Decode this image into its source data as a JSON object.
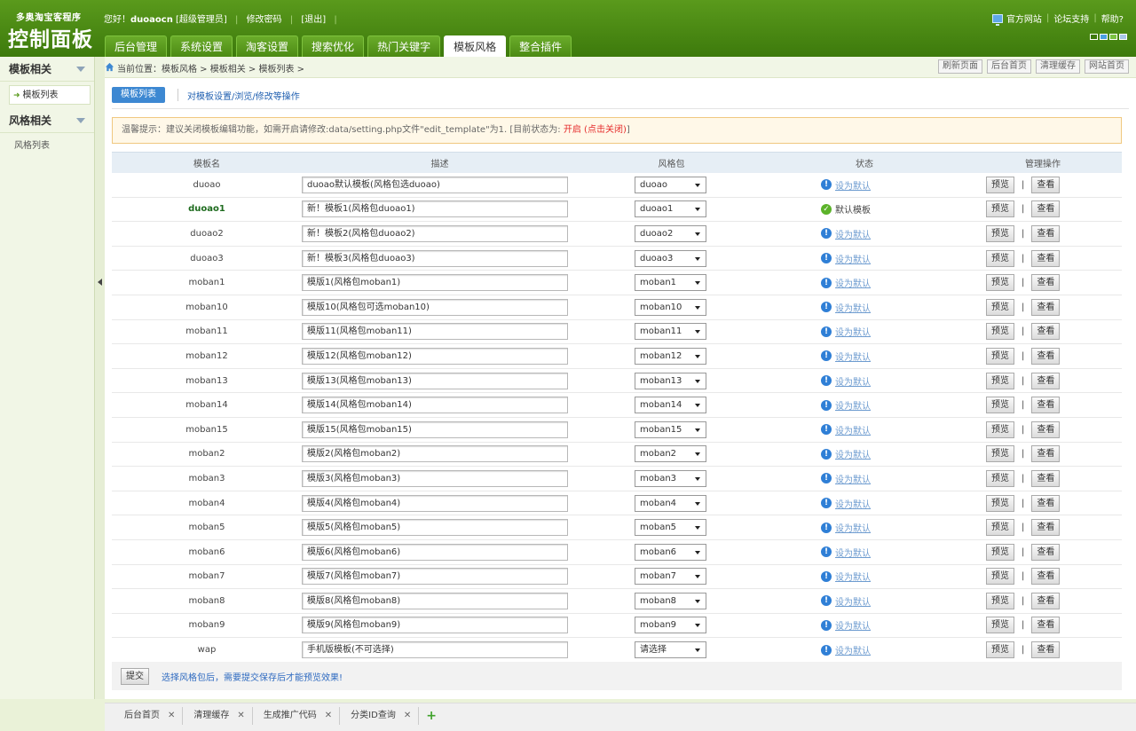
{
  "brand": {
    "small": "多奥淘宝客程序",
    "big": "控制面板"
  },
  "user": {
    "greeting": "您好！",
    "name": "duoaocn",
    "role": "[超级管理员]",
    "change_pwd": "修改密码",
    "logout": "[退出]"
  },
  "toplinks": {
    "site": "官方网站",
    "forum": "论坛支持",
    "help": "帮助?"
  },
  "tabs": [
    "后台管理",
    "系统设置",
    "淘客设置",
    "搜索优化",
    "热门关键字",
    "模板风格",
    "整合插件"
  ],
  "sidebar": {
    "group1": "模板相关",
    "group1_items": [
      "模板列表"
    ],
    "group2": "风格相关",
    "group2_items": [
      "风格列表"
    ]
  },
  "crumb": "当前位置：模板风格 > 模板相关 > 模板列表 >",
  "quick": [
    "刷新页面",
    "后台首页",
    "清理缓存",
    "网站首页"
  ],
  "subnav": {
    "tab": "模板列表",
    "link": "对模板设置/浏览/修改等操作"
  },
  "notice": {
    "prefix": "温馨提示：建议关闭模板编辑功能，如需开启请修改:data/setting.php文件\"edit_template\"为1.   [目前状态为: ",
    "state": "开启 (点击关闭)",
    "suffix": "]"
  },
  "table": {
    "headers": [
      "模板名",
      "描述",
      "风格包",
      "状态",
      "管理操作"
    ],
    "set_default": "设为默认",
    "is_default": "默认模板",
    "preview": "预览",
    "view": "查看",
    "pipe": "|",
    "rows": [
      {
        "name": "duoao",
        "desc": "duoao默认模板(风格包选duoao)",
        "pkg": "duoao"
      },
      {
        "name": "duoao1",
        "desc": "新！模板1(风格包duoao1)",
        "pkg": "duoao1"
      },
      {
        "name": "duoao2",
        "desc": "新！模板2(风格包duoao2)",
        "pkg": "duoao2"
      },
      {
        "name": "duoao3",
        "desc": "新！模板3(风格包duoao3)",
        "pkg": "duoao3"
      },
      {
        "name": "moban1",
        "desc": "模版1(风格包moban1)",
        "pkg": "moban1"
      },
      {
        "name": "moban10",
        "desc": "模版10(风格包可选moban10)",
        "pkg": "moban10"
      },
      {
        "name": "moban11",
        "desc": "模版11(风格包moban11)",
        "pkg": "moban11"
      },
      {
        "name": "moban12",
        "desc": "模版12(风格包moban12)",
        "pkg": "moban12"
      },
      {
        "name": "moban13",
        "desc": "模版13(风格包moban13)",
        "pkg": "moban13"
      },
      {
        "name": "moban14",
        "desc": "模版14(风格包moban14)",
        "pkg": "moban14"
      },
      {
        "name": "moban15",
        "desc": "模版15(风格包moban15)",
        "pkg": "moban15"
      },
      {
        "name": "moban2",
        "desc": "模版2(风格包moban2)",
        "pkg": "moban2"
      },
      {
        "name": "moban3",
        "desc": "模版3(风格包moban3)",
        "pkg": "moban3"
      },
      {
        "name": "moban4",
        "desc": "模版4(风格包moban4)",
        "pkg": "moban4"
      },
      {
        "name": "moban5",
        "desc": "模版5(风格包moban5)",
        "pkg": "moban5"
      },
      {
        "name": "moban6",
        "desc": "模版6(风格包moban6)",
        "pkg": "moban6"
      },
      {
        "name": "moban7",
        "desc": "模版7(风格包moban7)",
        "pkg": "moban7"
      },
      {
        "name": "moban8",
        "desc": "模版8(风格包moban8)",
        "pkg": "moban8"
      },
      {
        "name": "moban9",
        "desc": "模版9(风格包moban9)",
        "pkg": "moban9"
      },
      {
        "name": "wap",
        "desc": "手机版模板(不可选择)",
        "pkg": "请选择"
      }
    ]
  },
  "footer": {
    "submit": "提交",
    "note": "选择风格包后，需要提交保存后才能预览效果!"
  },
  "bottom_tabs": [
    "后台首页",
    "清理缓存",
    "生成推广代码",
    "分类ID查询"
  ],
  "colors": {
    "header": "#4c8a14",
    "accent_blue": "#3d88d2",
    "link": "#1f5fb0",
    "default_green": "#1e6b1e"
  }
}
